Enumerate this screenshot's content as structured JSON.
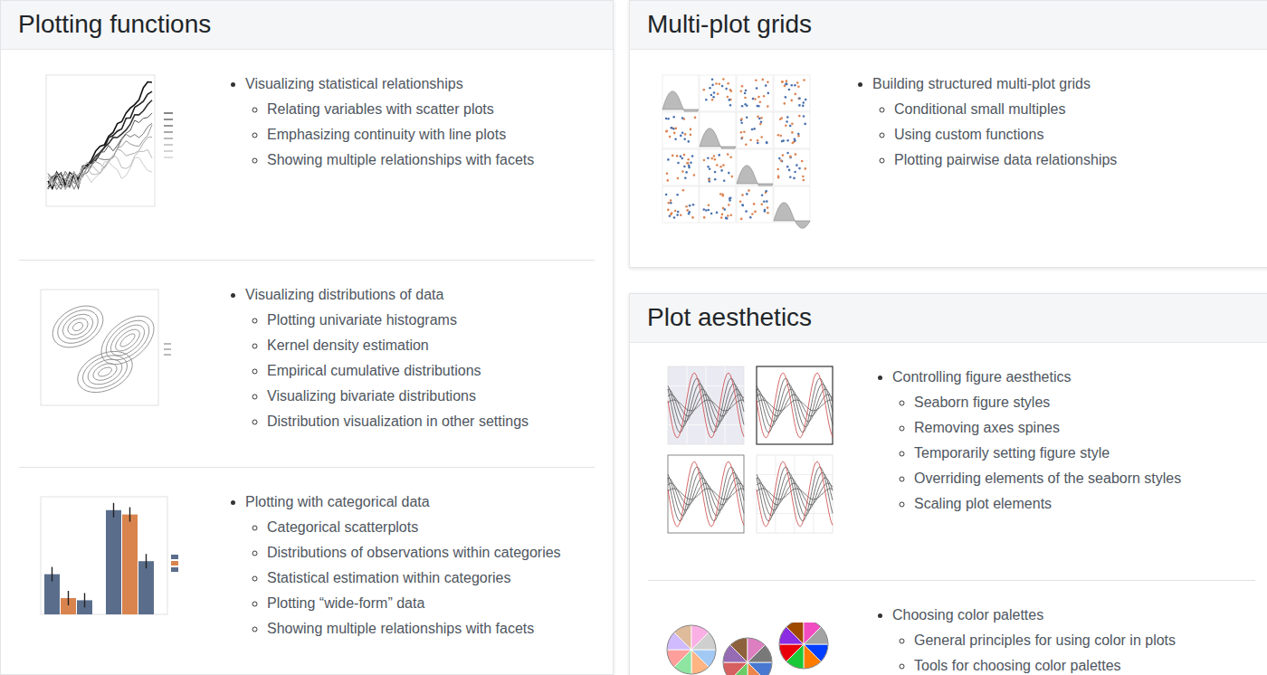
{
  "columns": [
    {
      "cards": [
        {
          "title": "Plotting functions",
          "rows": [
            {
              "kind": "lineplot",
              "item": "Visualizing statistical relationships",
              "subitems": [
                "Relating variables with scatter plots",
                "Emphasizing continuity with line plots",
                "Showing multiple relationships with facets"
              ]
            },
            {
              "kind": "kde",
              "item": "Visualizing distributions of data",
              "subitems": [
                "Plotting univariate histograms",
                "Kernel density estimation",
                "Empirical cumulative distributions",
                "Visualizing bivariate distributions",
                "Distribution visualization in other settings"
              ]
            },
            {
              "kind": "barplot",
              "item": "Plotting with categorical data",
              "subitems": [
                "Categorical scatterplots",
                "Distributions of observations within categories",
                "Statistical estimation within categories",
                "Plotting “wide-form” data",
                "Showing multiple relationships with facets"
              ]
            }
          ]
        }
      ]
    },
    {
      "cards": [
        {
          "title": "Multi-plot grids",
          "rows": [
            {
              "kind": "pairgrid",
              "item": "Building structured multi-plot grids",
              "subitems": [
                "Conditional small multiples",
                "Using custom functions",
                "Plotting pairwise data relationships"
              ]
            }
          ]
        },
        {
          "title": "Plot aesthetics",
          "rows": [
            {
              "kind": "styles",
              "item": "Controlling figure aesthetics",
              "subitems": [
                "Seaborn figure styles",
                "Removing axes spines",
                "Temporarily setting figure style",
                "Overriding elements of the seaborn styles",
                "Scaling plot elements"
              ]
            },
            {
              "kind": "palettes",
              "item": "Choosing color palettes",
              "subitems": [
                "General principles for using color in plots",
                "Tools for choosing color palettes"
              ]
            }
          ]
        }
      ]
    }
  ]
}
